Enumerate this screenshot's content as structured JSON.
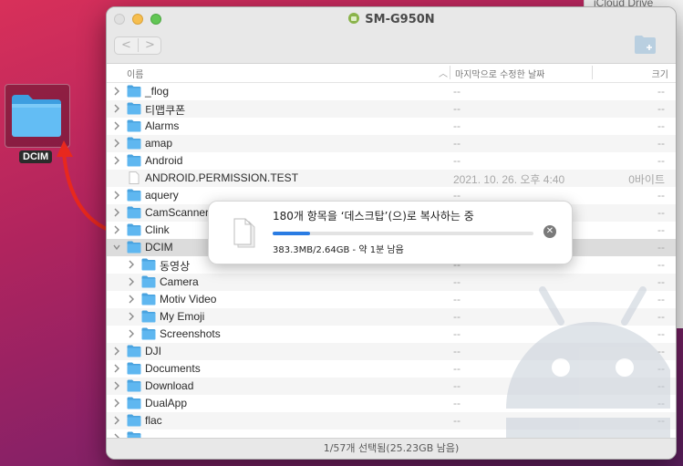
{
  "background_window": {
    "label": "iCloud Drive"
  },
  "desktop": {
    "icon_label": "DCIM"
  },
  "window": {
    "title": "SM-G950N",
    "nav": {
      "back": "<",
      "forward": ">"
    },
    "columns": {
      "name": "이름",
      "modified": "마지막으로 수정한 날짜",
      "size": "크기"
    },
    "rows": [
      {
        "name": "_flog",
        "date": "--",
        "size": "--",
        "kind": "folder",
        "level": 0
      },
      {
        "name": "티맵쿠폰",
        "date": "--",
        "size": "--",
        "kind": "folder",
        "level": 0
      },
      {
        "name": "Alarms",
        "date": "--",
        "size": "--",
        "kind": "folder",
        "level": 0
      },
      {
        "name": "amap",
        "date": "--",
        "size": "--",
        "kind": "folder",
        "level": 0
      },
      {
        "name": "Android",
        "date": "--",
        "size": "--",
        "kind": "folder",
        "level": 0
      },
      {
        "name": "ANDROID.PERMISSION.TEST",
        "date": "2021. 10. 26. 오후 4:40",
        "size": "0바이트",
        "kind": "file",
        "level": 0
      },
      {
        "name": "aquery",
        "date": "--",
        "size": "--",
        "kind": "folder",
        "level": 0
      },
      {
        "name": "CamScanner",
        "date": "--",
        "size": "--",
        "kind": "folder",
        "level": 0
      },
      {
        "name": "Clink",
        "date": "--",
        "size": "--",
        "kind": "folder",
        "level": 0
      },
      {
        "name": "DCIM",
        "date": "--",
        "size": "--",
        "kind": "folder",
        "level": 0,
        "expanded": true,
        "selected": true
      },
      {
        "name": "동영상",
        "date": "--",
        "size": "--",
        "kind": "folder",
        "level": 1
      },
      {
        "name": "Camera",
        "date": "--",
        "size": "--",
        "kind": "folder",
        "level": 1
      },
      {
        "name": "Motiv Video",
        "date": "--",
        "size": "--",
        "kind": "folder",
        "level": 1
      },
      {
        "name": "My Emoji",
        "date": "--",
        "size": "--",
        "kind": "folder",
        "level": 1
      },
      {
        "name": "Screenshots",
        "date": "--",
        "size": "--",
        "kind": "folder",
        "level": 1
      },
      {
        "name": "DJI",
        "date": "--",
        "size": "--",
        "kind": "folder",
        "level": 0
      },
      {
        "name": "Documents",
        "date": "--",
        "size": "--",
        "kind": "folder",
        "level": 0
      },
      {
        "name": "Download",
        "date": "--",
        "size": "--",
        "kind": "folder",
        "level": 0
      },
      {
        "name": "DualApp",
        "date": "--",
        "size": "--",
        "kind": "folder",
        "level": 0
      },
      {
        "name": "flac",
        "date": "--",
        "size": "--",
        "kind": "folder",
        "level": 0
      },
      {
        "name": "",
        "date": "",
        "size": "",
        "kind": "folder",
        "level": 0
      }
    ],
    "status": "1/57개 선택됨(25.23GB 남음)"
  },
  "copy_dialog": {
    "message": "180개 항목을 ‘데스크탑’(으)로 복사하는 중",
    "progress": 0.145,
    "stats": "383.3MB/2.64GB - 약 1분 남음"
  },
  "colors": {
    "folder": "#5fb7f0",
    "accent": "#2a7ce3",
    "arrow": "#e8281e"
  }
}
